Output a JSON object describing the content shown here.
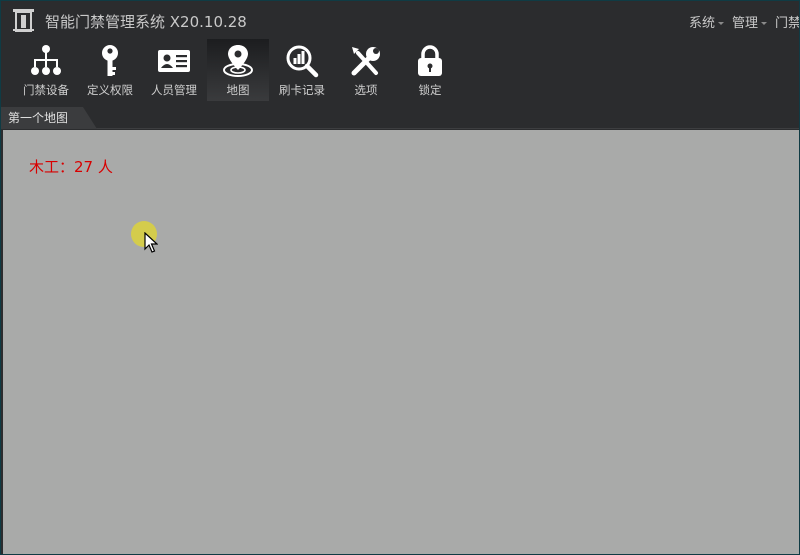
{
  "app": {
    "title": "智能门禁管理系统 X20.10.28"
  },
  "top_menu": [
    {
      "label": "系统"
    },
    {
      "label": "管理"
    },
    {
      "label": "门禁"
    }
  ],
  "toolbar": [
    {
      "label": "门禁设备",
      "icon": "org-tree-icon"
    },
    {
      "label": "定义权限",
      "icon": "key-icon"
    },
    {
      "label": "人员管理",
      "icon": "id-card-icon"
    },
    {
      "label": "地图",
      "icon": "map-pin-icon",
      "active": true
    },
    {
      "label": "刷卡记录",
      "icon": "search-chart-icon"
    },
    {
      "label": "选项",
      "icon": "tools-icon"
    },
    {
      "label": "锁定",
      "icon": "lock-icon"
    }
  ],
  "tabs": [
    {
      "label": "第一个地图",
      "active": true
    }
  ],
  "map": {
    "area_label": "木工：27 人"
  },
  "colors": {
    "background": "#2b2c2e",
    "canvas": "#a9aaa9",
    "label_red": "#d80000",
    "text": "#cfcfcf"
  }
}
